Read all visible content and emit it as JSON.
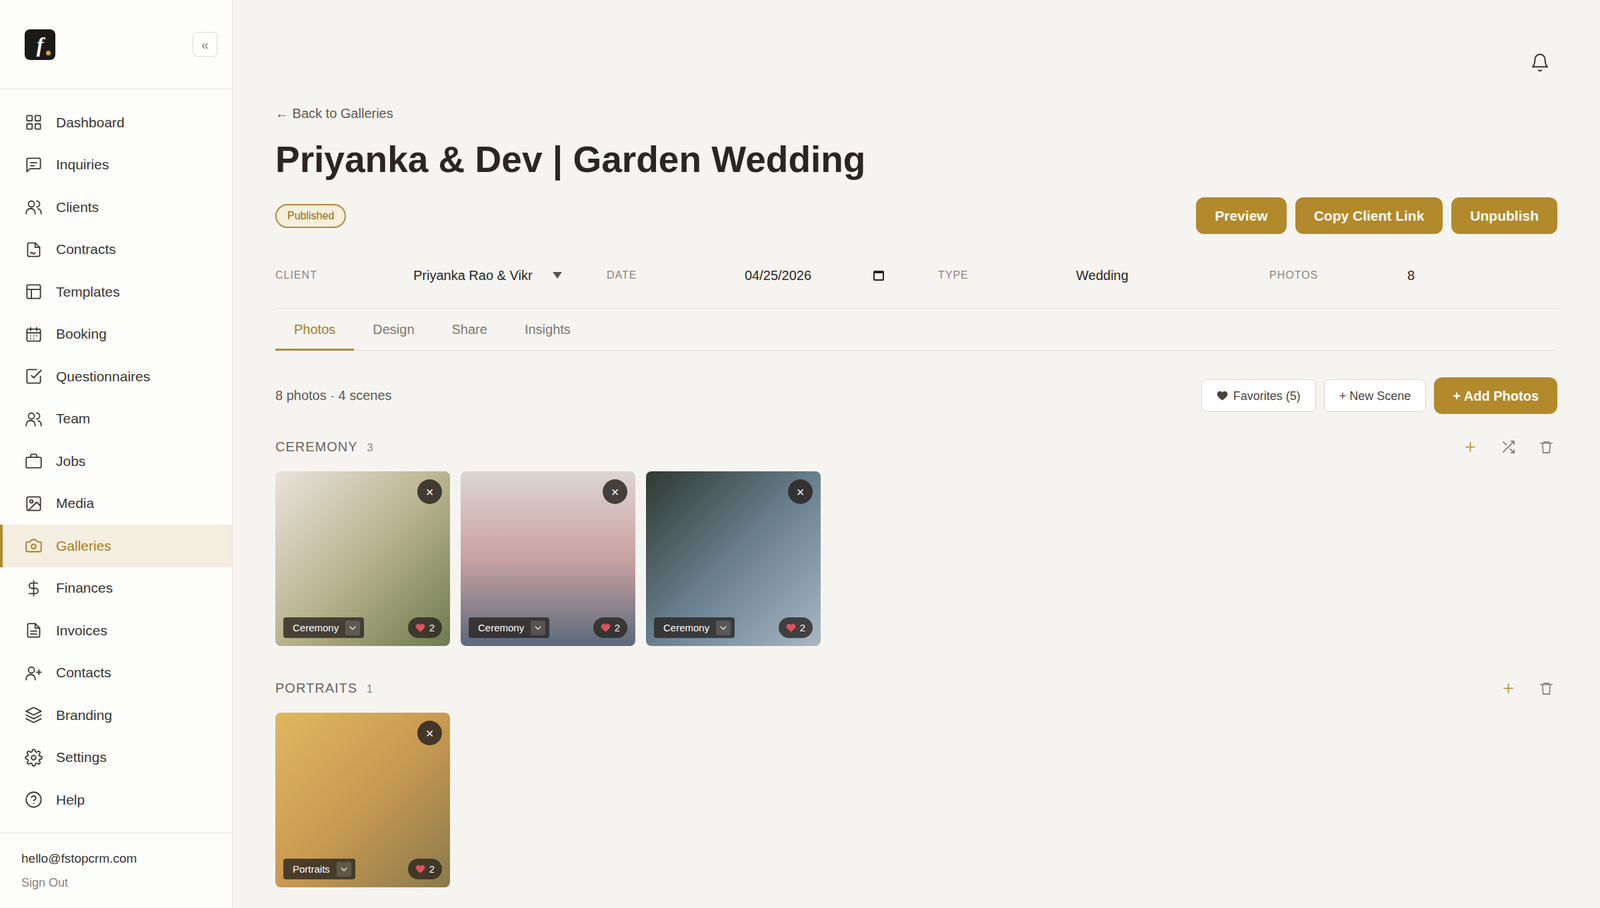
{
  "logo": {
    "letter": "f"
  },
  "sidebar": {
    "collapse": "«",
    "items": [
      {
        "label": "Dashboard",
        "selected": false
      },
      {
        "label": "Inquiries",
        "selected": false
      },
      {
        "label": "Clients",
        "selected": false
      },
      {
        "label": "Contracts",
        "selected": false
      },
      {
        "label": "Templates",
        "selected": false
      },
      {
        "label": "Booking",
        "selected": false
      },
      {
        "label": "Questionnaires",
        "selected": false
      },
      {
        "label": "Team",
        "selected": false
      },
      {
        "label": "Jobs",
        "selected": false
      },
      {
        "label": "Media",
        "selected": false
      },
      {
        "label": "Galleries",
        "selected": true
      },
      {
        "label": "Finances",
        "selected": false
      },
      {
        "label": "Invoices",
        "selected": false
      },
      {
        "label": "Contacts",
        "selected": false
      },
      {
        "label": "Branding",
        "selected": false
      },
      {
        "label": "Settings",
        "selected": false
      },
      {
        "label": "Help",
        "selected": false
      }
    ],
    "footer": {
      "email": "hello@fstopcrm.com",
      "sign_out": "Sign Out"
    }
  },
  "header": {
    "back": "← Back to Galleries",
    "title": "Priyanka & Dev | Garden Wedding",
    "status": "Published",
    "buttons": [
      "Preview",
      "Copy Client Link",
      "Unpublish"
    ]
  },
  "details": [
    {
      "label": "CLIENT",
      "value": "Priyanka Rao & Vikr",
      "kind": "select"
    },
    {
      "label": "DATE",
      "value": "04/25/2026",
      "kind": "date"
    },
    {
      "label": "TYPE",
      "value": "Wedding",
      "kind": "text"
    },
    {
      "label": "PHOTOS",
      "value": "8",
      "kind": "text"
    }
  ],
  "tabs": [
    {
      "label": "Photos",
      "selected": true
    },
    {
      "label": "Design",
      "selected": false
    },
    {
      "label": "Share",
      "selected": false
    },
    {
      "label": "Insights",
      "selected": false
    }
  ],
  "toolbar": {
    "summary": "8 photos · 4 scenes",
    "favorites": "Favorites (5)",
    "new_scene": "+ New Scene",
    "add_photos": "+ Add Photos"
  },
  "scenes": [
    {
      "name": "CEREMONY",
      "count": "3",
      "actions": [
        {
          "kind": "add"
        },
        {
          "kind": "shuffle"
        },
        {
          "kind": "delete"
        }
      ],
      "photos": [
        {
          "remove": "×",
          "scene": "Ceremony",
          "likes": "2"
        },
        {
          "remove": "×",
          "scene": "Ceremony",
          "likes": "2"
        },
        {
          "remove": "×",
          "scene": "Ceremony",
          "likes": "2"
        }
      ]
    },
    {
      "name": "PORTRAITS",
      "count": "1",
      "actions": [
        {
          "kind": "add"
        },
        {
          "kind": "delete"
        }
      ],
      "photos": [
        {
          "remove": "×",
          "scene": "Portraits",
          "likes": "2"
        }
      ]
    }
  ]
}
